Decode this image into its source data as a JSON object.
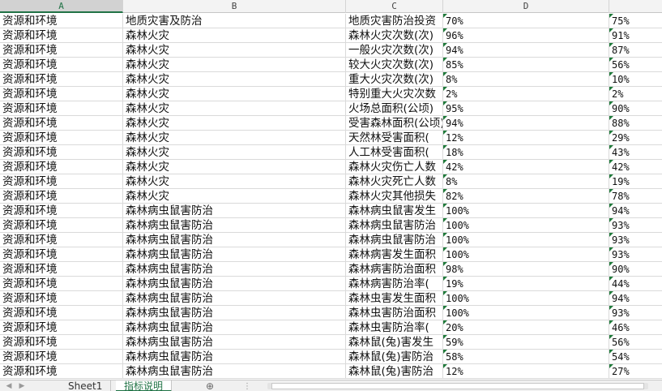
{
  "columns": [
    "A",
    "B",
    "C",
    "D"
  ],
  "rows": [
    {
      "a": "资源和环境",
      "b": "地质灾害及防治",
      "c": "地质灾害防治投资",
      "d": "70%",
      "e": "75%"
    },
    {
      "a": "资源和环境",
      "b": "森林火灾",
      "c": "森林火灾次数(次)",
      "d": "96%",
      "e": "91%"
    },
    {
      "a": "资源和环境",
      "b": "森林火灾",
      "c": "一般火灾次数(次)",
      "d": "94%",
      "e": "87%"
    },
    {
      "a": "资源和环境",
      "b": "森林火灾",
      "c": "较大火灾次数(次)",
      "d": "85%",
      "e": "56%"
    },
    {
      "a": "资源和环境",
      "b": "森林火灾",
      "c": "重大火灾次数(次)",
      "d": "8%",
      "e": "10%"
    },
    {
      "a": "资源和环境",
      "b": "森林火灾",
      "c": "特别重大火灾次数",
      "d": "2%",
      "e": "2%"
    },
    {
      "a": "资源和环境",
      "b": "森林火灾",
      "c": "火场总面积(公顷)",
      "d": "95%",
      "e": "90%"
    },
    {
      "a": "资源和环境",
      "b": "森林火灾",
      "c": "受害森林面积(公顷)",
      "d": "94%",
      "e": "88%"
    },
    {
      "a": "资源和环境",
      "b": "森林火灾",
      "c": "天然林受害面积(",
      "d": "12%",
      "e": "29%"
    },
    {
      "a": "资源和环境",
      "b": "森林火灾",
      "c": "人工林受害面积(",
      "d": "18%",
      "e": "43%"
    },
    {
      "a": "资源和环境",
      "b": "森林火灾",
      "c": "森林火灾伤亡人数",
      "d": "42%",
      "e": "42%"
    },
    {
      "a": "资源和环境",
      "b": "森林火灾",
      "c": "森林火灾死亡人数",
      "d": "8%",
      "e": "19%"
    },
    {
      "a": "资源和环境",
      "b": "森林火灾",
      "c": "森林火灾其他损失",
      "d": "82%",
      "e": "78%"
    },
    {
      "a": "资源和环境",
      "b": "森林病虫鼠害防治",
      "c": "森林病虫鼠害发生",
      "d": "100%",
      "e": "94%"
    },
    {
      "a": "资源和环境",
      "b": "森林病虫鼠害防治",
      "c": "森林病虫鼠害防治",
      "d": "100%",
      "e": "93%"
    },
    {
      "a": "资源和环境",
      "b": "森林病虫鼠害防治",
      "c": "森林病虫鼠害防治",
      "d": "100%",
      "e": "93%"
    },
    {
      "a": "资源和环境",
      "b": "森林病虫鼠害防治",
      "c": "森林病害发生面积",
      "d": "100%",
      "e": "93%"
    },
    {
      "a": "资源和环境",
      "b": "森林病虫鼠害防治",
      "c": "森林病害防治面积",
      "d": "98%",
      "e": "90%"
    },
    {
      "a": "资源和环境",
      "b": "森林病虫鼠害防治",
      "c": "森林病害防治率(",
      "d": "19%",
      "e": "44%"
    },
    {
      "a": "资源和环境",
      "b": "森林病虫鼠害防治",
      "c": "森林虫害发生面积",
      "d": "100%",
      "e": "94%"
    },
    {
      "a": "资源和环境",
      "b": "森林病虫鼠害防治",
      "c": "森林虫害防治面积",
      "d": "100%",
      "e": "93%"
    },
    {
      "a": "资源和环境",
      "b": "森林病虫鼠害防治",
      "c": "森林虫害防治率(",
      "d": "20%",
      "e": "46%"
    },
    {
      "a": "资源和环境",
      "b": "森林病虫鼠害防治",
      "c": "森林鼠(兔)害发生",
      "d": "59%",
      "e": "56%"
    },
    {
      "a": "资源和环境",
      "b": "森林病虫鼠害防治",
      "c": "森林鼠(兔)害防治",
      "d": "58%",
      "e": "54%"
    },
    {
      "a": "资源和环境",
      "b": "森林病虫鼠害防治",
      "c": "森林鼠(兔)害防治",
      "d": "12%",
      "e": "27%"
    }
  ],
  "tabs": {
    "sheet1": "Sheet1",
    "active": "指标说明"
  },
  "tabbar": {
    "add_icon": "⊕",
    "dots": "⋮"
  },
  "colors": {
    "accent": "#217346",
    "flag": "#1f7a3a",
    "grid": "#dadada"
  }
}
